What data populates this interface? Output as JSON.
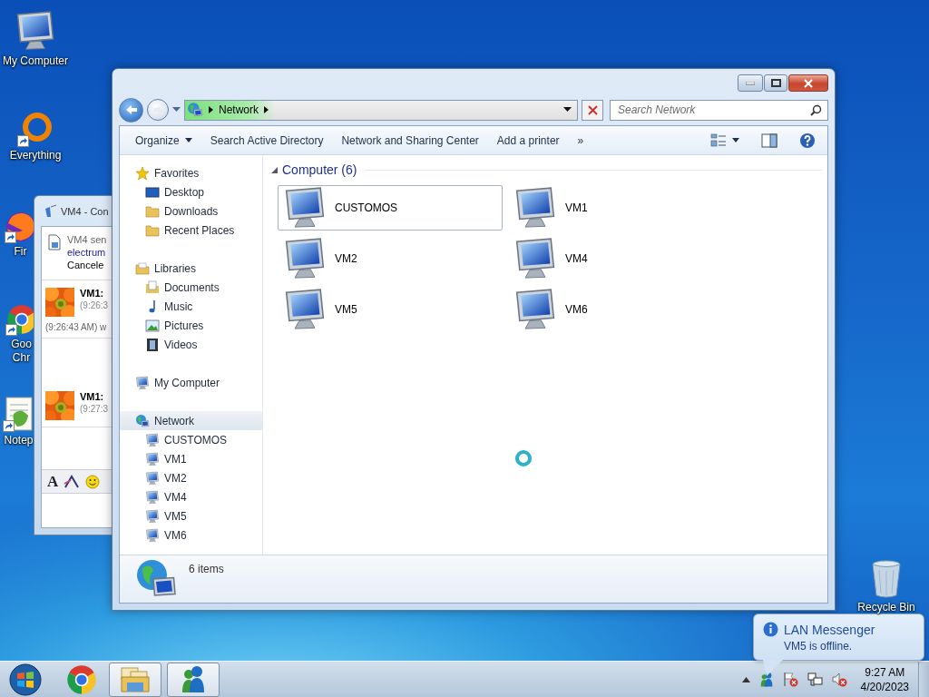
{
  "desktop_icons": [
    {
      "label": "My Computer",
      "kind": "computer",
      "shortcut": false
    },
    {
      "label": "Everything",
      "kind": "everything",
      "shortcut": true
    },
    {
      "label": "Fir",
      "kind": "firefox",
      "shortcut": true
    },
    {
      "label": "Goo Chr",
      "kind": "chrome",
      "shortcut": true
    },
    {
      "label": "Notep",
      "kind": "notepad",
      "shortcut": true
    },
    {
      "label": "Recycle Bin",
      "kind": "recycle",
      "shortcut": false
    }
  ],
  "chat_window": {
    "title": "VM4 - Con",
    "transfer": {
      "status": "VM4 sen",
      "file": "electrum",
      "state": "Cancele"
    },
    "messages": [
      {
        "sender": "VM1:",
        "time": "(9:26:3",
        "body": "(9:26:43 AM) w"
      },
      {
        "sender": "VM1:",
        "time": "(9:27:3"
      }
    ],
    "font_button": "A"
  },
  "explorer": {
    "breadcrumb": [
      "Network"
    ],
    "search": {
      "placeholder": "Search Network"
    },
    "commands": [
      {
        "label": "Organize",
        "menu": true
      },
      {
        "label": "Search Active Directory",
        "menu": false
      },
      {
        "label": "Network and Sharing Center",
        "menu": false
      },
      {
        "label": "Add a printer",
        "menu": false
      }
    ],
    "more": "»",
    "navigation": [
      {
        "label": "Favorites",
        "kind": "star",
        "selected": false,
        "children": [
          {
            "label": "Desktop",
            "kind": "desktop",
            "selected": false
          },
          {
            "label": "Downloads",
            "kind": "folder",
            "selected": false
          },
          {
            "label": "Recent Places",
            "kind": "folder",
            "selected": false
          }
        ]
      },
      {
        "label": "Libraries",
        "kind": "library",
        "selected": false,
        "children": [
          {
            "label": "Documents",
            "kind": "document",
            "selected": false
          },
          {
            "label": "Music",
            "kind": "music",
            "selected": false
          },
          {
            "label": "Pictures",
            "kind": "picture",
            "selected": false
          },
          {
            "label": "Videos",
            "kind": "video",
            "selected": false
          }
        ]
      },
      {
        "label": "My Computer",
        "kind": "computer",
        "selected": false
      },
      {
        "label": "Network",
        "kind": "network",
        "selected": true,
        "children": [
          {
            "label": "CUSTOMOS",
            "kind": "computer",
            "selected": false
          },
          {
            "label": "VM1",
            "kind": "computer",
            "selected": false
          },
          {
            "label": "VM2",
            "kind": "computer",
            "selected": false
          },
          {
            "label": "VM4",
            "kind": "computer",
            "selected": false
          },
          {
            "label": "VM5",
            "kind": "computer",
            "selected": false
          },
          {
            "label": "VM6",
            "kind": "computer",
            "selected": false
          }
        ]
      }
    ],
    "group": {
      "title": "Computer (6)",
      "items": [
        {
          "name": "CUSTOMOS",
          "selected": true
        },
        {
          "name": "VM1",
          "selected": false
        },
        {
          "name": "VM2",
          "selected": false
        },
        {
          "name": "VM4",
          "selected": false
        },
        {
          "name": "VM5",
          "selected": false
        },
        {
          "name": "VM6",
          "selected": false
        }
      ]
    },
    "details": "6 items"
  },
  "taskbar": {
    "apps": [
      {
        "kind": "chrome",
        "running": false
      },
      {
        "kind": "explorer",
        "running": true
      },
      {
        "kind": "messenger",
        "running": true
      }
    ],
    "tray": {
      "icons": [
        {
          "kind": "arrow"
        },
        {
          "kind": "messenger"
        },
        {
          "kind": "flag",
          "alert": true
        },
        {
          "kind": "network"
        },
        {
          "kind": "volume",
          "alert": true
        }
      ],
      "time": "9:27 AM",
      "date": "4/20/2023"
    }
  },
  "balloon": {
    "title": "LAN Messenger",
    "message": "VM5 is offline."
  }
}
